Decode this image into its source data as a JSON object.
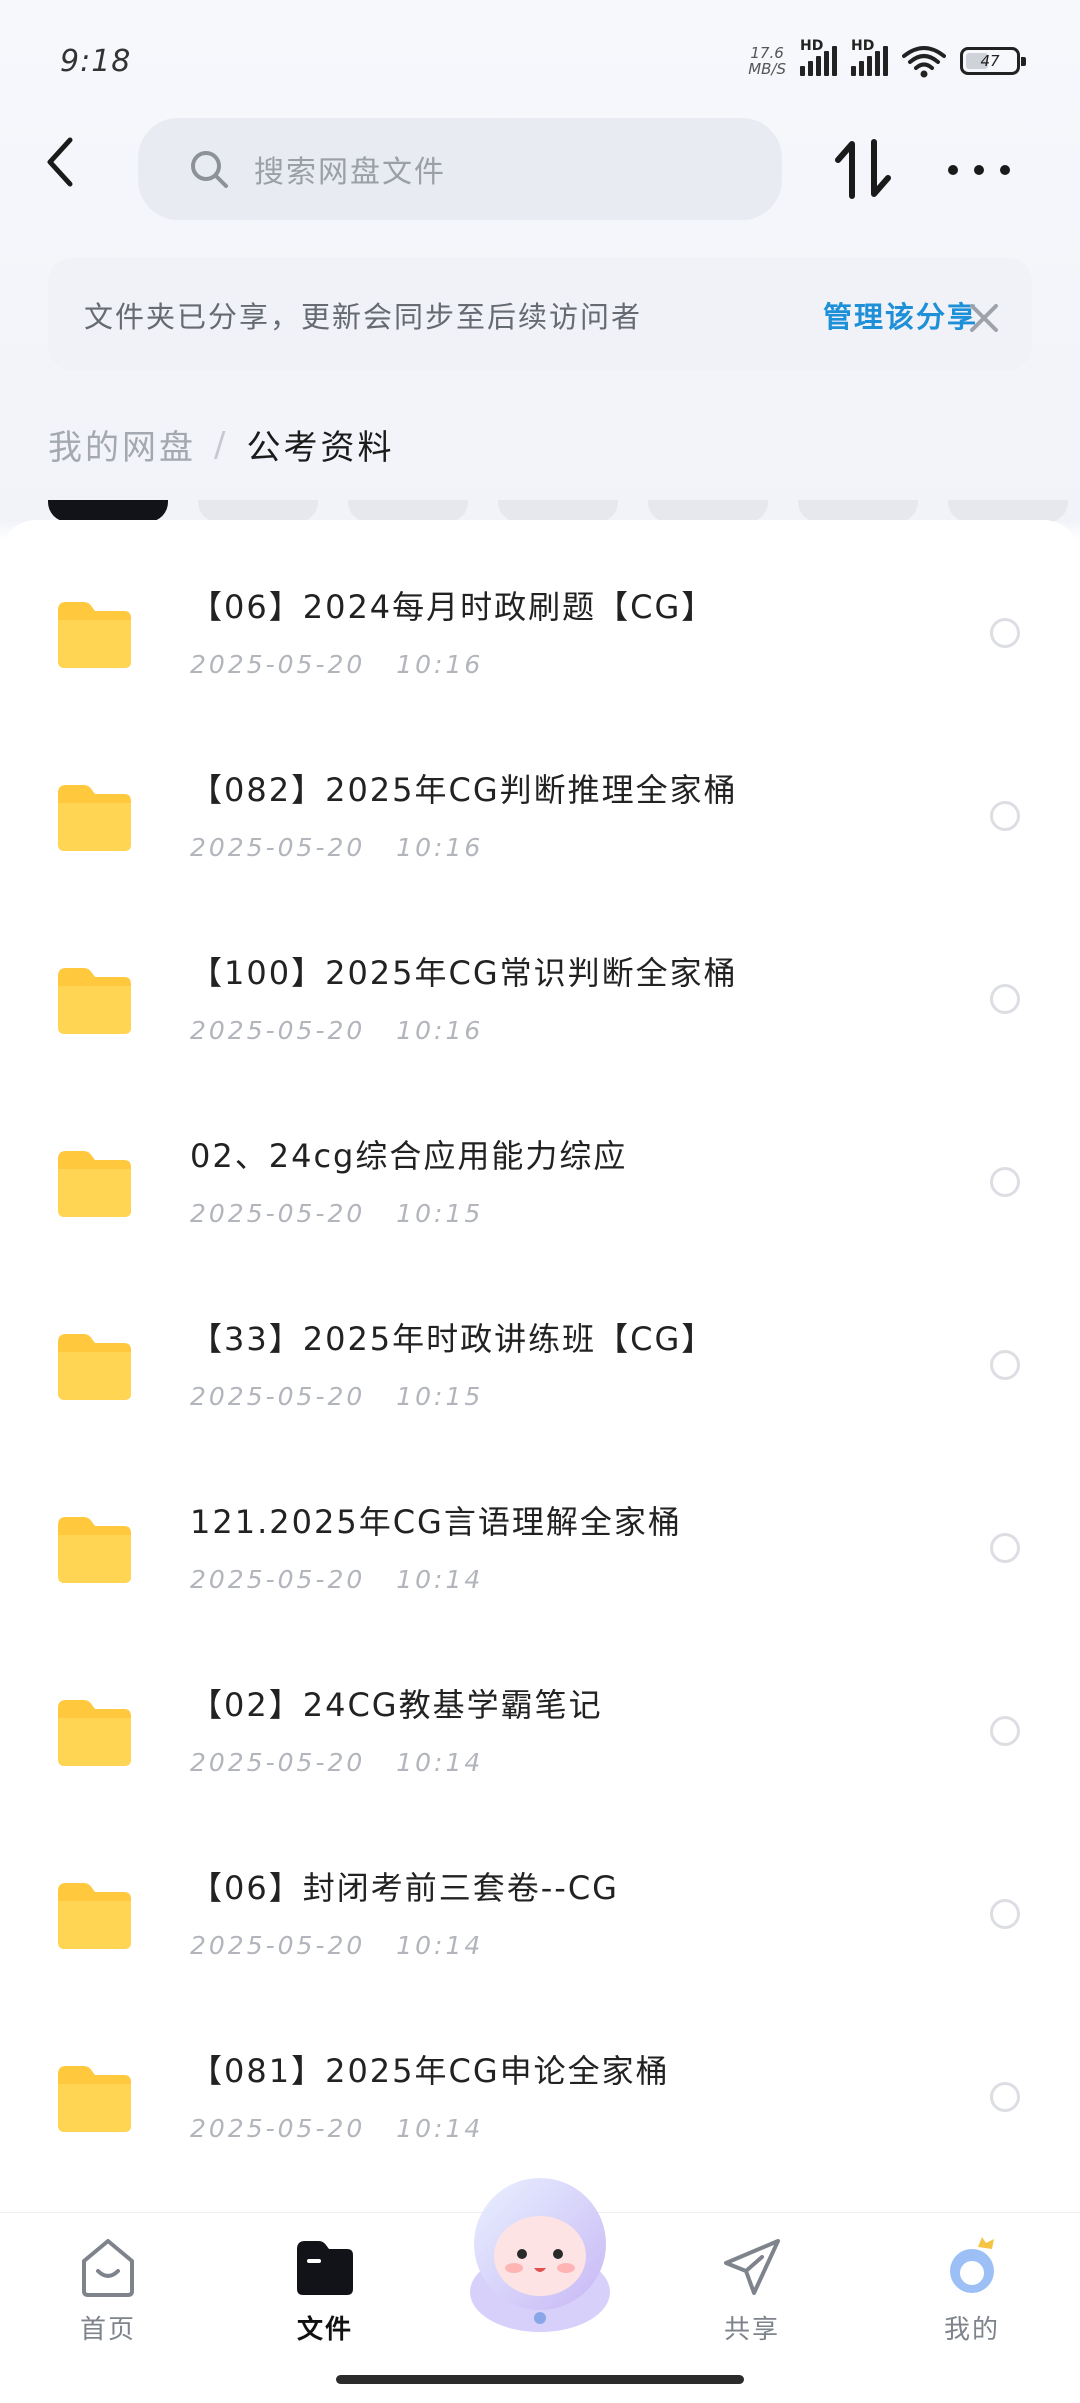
{
  "status_bar": {
    "time": "9:18",
    "net_speed_value": "17.6",
    "net_speed_unit": "MB/S",
    "sim1_label": "HD",
    "sim2_label": "HD",
    "battery": "47"
  },
  "header": {
    "search_placeholder": "搜索网盘文件"
  },
  "notice": {
    "text": "文件夹已分享，更新会同步至后续访问者",
    "link": "管理该分享"
  },
  "breadcrumb": {
    "root": "我的网盘",
    "separator": "/",
    "current": "公考资料"
  },
  "files": [
    {
      "name": "【06】2024每月时政刷题【CG】",
      "date": "2025-05-20",
      "time": "10:16"
    },
    {
      "name": "【082】2025年CG判断推理全家桶",
      "date": "2025-05-20",
      "time": "10:16"
    },
    {
      "name": "【100】2025年CG常识判断全家桶",
      "date": "2025-05-20",
      "time": "10:16"
    },
    {
      "name": "02、24cg综合应用能力综应",
      "date": "2025-05-20",
      "time": "10:15"
    },
    {
      "name": "【33】2025年时政讲练班【CG】",
      "date": "2025-05-20",
      "time": "10:15"
    },
    {
      "name": "121.2025年CG言语理解全家桶",
      "date": "2025-05-20",
      "time": "10:14"
    },
    {
      "name": "【02】24CG教基学霸笔记",
      "date": "2025-05-20",
      "time": "10:14"
    },
    {
      "name": "【06】封闭考前三套卷--CG",
      "date": "2025-05-20",
      "time": "10:14"
    },
    {
      "name": "【081】2025年CG申论全家桶",
      "date": "2025-05-20",
      "time": "10:14"
    }
  ],
  "nav": {
    "home": "首页",
    "files": "文件",
    "share": "共享",
    "mine": "我的"
  },
  "colors": {
    "accent_link": "#1e90d8",
    "folder": "#ffc83d",
    "active_tab": "#121318"
  }
}
